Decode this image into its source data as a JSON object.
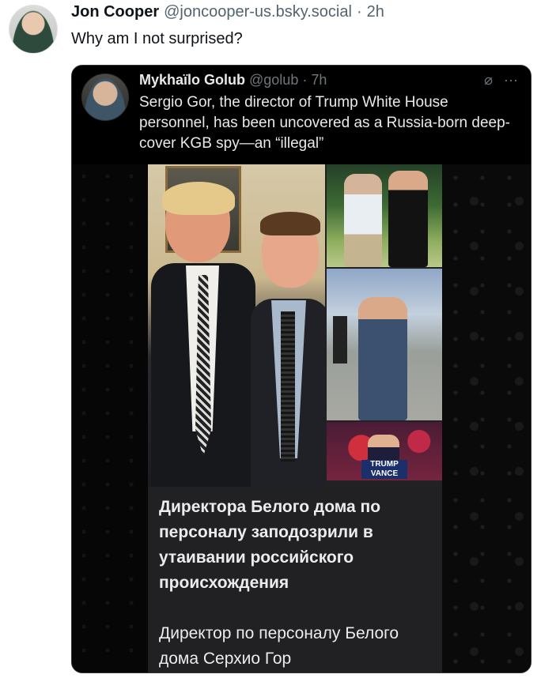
{
  "outer_post": {
    "name": "Jon Cooper",
    "handle": "@joncooper-us.bsky.social",
    "separator": "·",
    "time": "2h",
    "text": "Why am I not surprised?"
  },
  "quoted_post": {
    "name": "Mykhaïlo Golub",
    "handle": "@golub",
    "separator": "·",
    "time": "7h",
    "text": "Sergio Gor, the director of Trump White House personnel, has been uncovered as a Russia-born deep-cover KGB spy—an “illegal”",
    "icons": [
      "grok-icon",
      "more-icon"
    ]
  },
  "media_card": {
    "headline": "Директора Белого дома по персоналу заподозрили в утаивании российского происхождения",
    "subtext": "Директор по персоналу Белого дома Серхио Гор",
    "rally_sign": "TRUMP VANCE"
  }
}
